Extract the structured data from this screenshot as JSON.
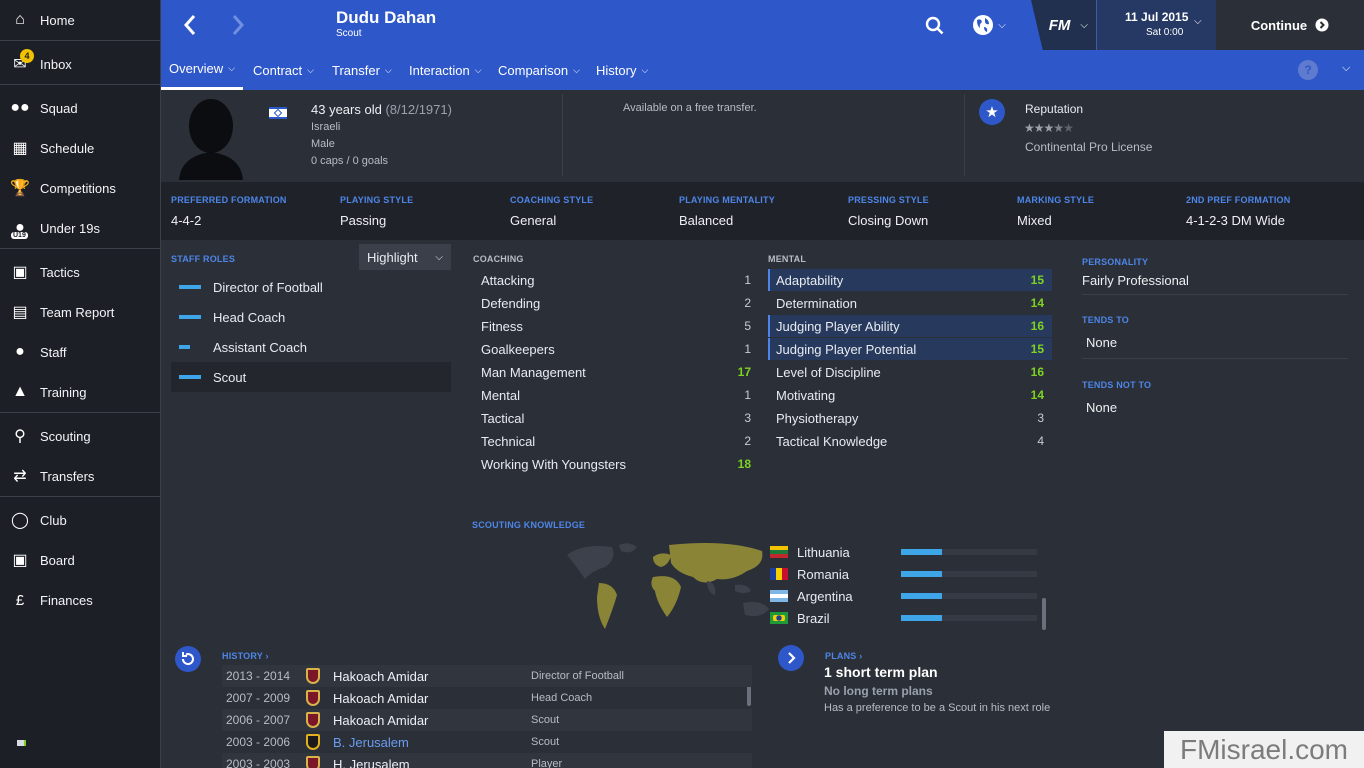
{
  "sidebar": {
    "items": [
      {
        "label": "Home",
        "icon": "home-icon"
      },
      {
        "label": "Inbox",
        "icon": "inbox-icon",
        "badge": "4"
      },
      {
        "label": "Squad",
        "icon": "squad-icon"
      },
      {
        "label": "Schedule",
        "icon": "calendar-icon"
      },
      {
        "label": "Competitions",
        "icon": "trophy-icon"
      },
      {
        "label": "Under 19s",
        "icon": "under19s-icon",
        "badge_text": "U19"
      },
      {
        "label": "Tactics",
        "icon": "tactics-icon"
      },
      {
        "label": "Team Report",
        "icon": "report-icon"
      },
      {
        "label": "Staff",
        "icon": "staff-icon"
      },
      {
        "label": "Training",
        "icon": "training-icon"
      },
      {
        "label": "Scouting",
        "icon": "search-icon"
      },
      {
        "label": "Transfers",
        "icon": "transfers-icon"
      },
      {
        "label": "Club",
        "icon": "shield-icon"
      },
      {
        "label": "Board",
        "icon": "board-icon"
      },
      {
        "label": "Finances",
        "icon": "finances-icon"
      }
    ]
  },
  "header": {
    "name": "Dudu Dahan",
    "role": "Scout",
    "date": "11 Jul 2015",
    "time": "Sat 0:00",
    "continue_label": "Continue",
    "logo_text": "FM"
  },
  "subnav": {
    "tabs": [
      {
        "label": "Overview"
      },
      {
        "label": "Contract"
      },
      {
        "label": "Transfer"
      },
      {
        "label": "Interaction"
      },
      {
        "label": "Comparison"
      },
      {
        "label": "History"
      }
    ],
    "help": "?"
  },
  "profile": {
    "age": "43 years old",
    "dob": "(8/12/1971)",
    "nationality": "Israeli",
    "gender": "Male",
    "caps": "0 caps / 0 goals",
    "transfer_status": "Available on a free transfer.",
    "reputation_label": "Reputation",
    "reputation_stars": 3.5,
    "license": "Continental Pro License"
  },
  "styles": [
    {
      "label": "PREFERRED FORMATION",
      "value": "4-4-2"
    },
    {
      "label": "PLAYING STYLE",
      "value": "Passing"
    },
    {
      "label": "COACHING STYLE",
      "value": "General"
    },
    {
      "label": "PLAYING MENTALITY",
      "value": "Balanced"
    },
    {
      "label": "PRESSING STYLE",
      "value": "Closing Down"
    },
    {
      "label": "MARKING STYLE",
      "value": "Mixed"
    },
    {
      "label": "2ND PREF FORMATION",
      "value": "4-1-2-3 DM Wide"
    }
  ],
  "staff_roles": {
    "title": "STAFF ROLES",
    "highlight_label": "Highlight",
    "roles": [
      {
        "label": "Director of Football",
        "bar": 1.0
      },
      {
        "label": "Head Coach",
        "bar": 1.0
      },
      {
        "label": "Assistant Coach",
        "bar": 0.5
      },
      {
        "label": "Scout",
        "bar": 1.0
      }
    ]
  },
  "coaching": {
    "title": "COACHING",
    "attrs": [
      {
        "label": "Attacking",
        "value": "1"
      },
      {
        "label": "Defending",
        "value": "2"
      },
      {
        "label": "Fitness",
        "value": "5"
      },
      {
        "label": "Goalkeepers",
        "value": "1"
      },
      {
        "label": "Man Management",
        "value": "17"
      },
      {
        "label": "Mental",
        "value": "1"
      },
      {
        "label": "Tactical",
        "value": "3"
      },
      {
        "label": "Technical",
        "value": "2"
      },
      {
        "label": "Working With Youngsters",
        "value": "18"
      }
    ]
  },
  "mental": {
    "title": "MENTAL",
    "attrs": [
      {
        "label": "Adaptability",
        "value": "15"
      },
      {
        "label": "Determination",
        "value": "14"
      },
      {
        "label": "Judging Player Ability",
        "value": "16"
      },
      {
        "label": "Judging Player Potential",
        "value": "15"
      },
      {
        "label": "Level of Discipline",
        "value": "16"
      },
      {
        "label": "Motivating",
        "value": "14"
      },
      {
        "label": "Physiotherapy",
        "value": "3"
      },
      {
        "label": "Tactical Knowledge",
        "value": "4"
      }
    ]
  },
  "personality": {
    "personality_label": "PERSONALITY",
    "personality_value": "Fairly Professional",
    "tends_to_label": "TENDS TO",
    "tends_to_value": "None",
    "tends_not_to_label": "TENDS NOT TO",
    "tends_not_to_value": "None"
  },
  "scouting": {
    "title": "SCOUTING KNOWLEDGE",
    "countries": [
      {
        "name": "Lithuania",
        "knowledge": 0.3
      },
      {
        "name": "Romania",
        "knowledge": 0.3
      },
      {
        "name": "Argentina",
        "knowledge": 0.3
      },
      {
        "name": "Brazil",
        "knowledge": 0.3
      }
    ]
  },
  "history": {
    "title": "HISTORY",
    "rows": [
      {
        "years": "2013 - 2014",
        "club": "Hakoach Amidar",
        "role": "Director of Football",
        "link": false
      },
      {
        "years": "2007 - 2009",
        "club": "Hakoach Amidar",
        "role": "Head Coach",
        "link": false
      },
      {
        "years": "2006 - 2007",
        "club": "Hakoach Amidar",
        "role": "Scout",
        "link": false
      },
      {
        "years": "2003 - 2006",
        "club": "B. Jerusalem",
        "role": "Scout",
        "link": true
      },
      {
        "years": "2003 - 2003",
        "club": "H. Jerusalem",
        "role": "Player",
        "link": false
      }
    ]
  },
  "plans": {
    "title": "PLANS",
    "short_term": "1 short term plan",
    "long_term": "No long term plans",
    "preference": "Has a preference to be a Scout in his next role"
  },
  "watermark": "FMisrael.com"
}
